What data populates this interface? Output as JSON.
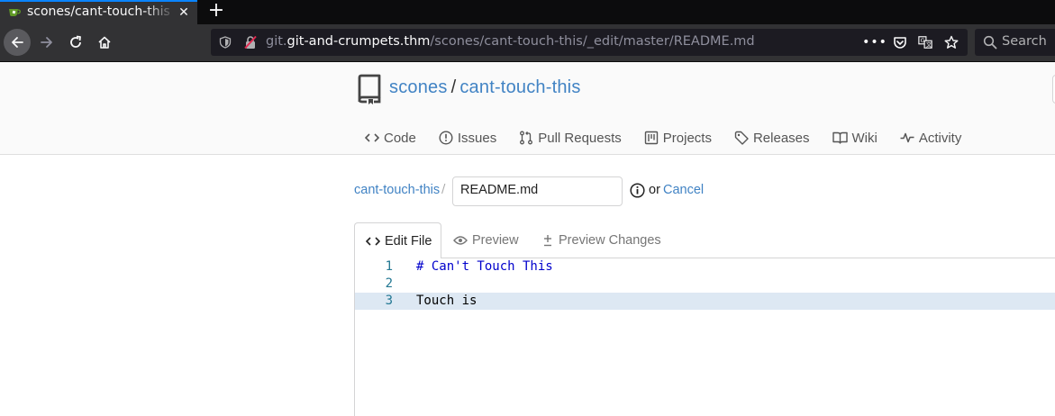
{
  "browser": {
    "tab_title": "scones/cant-touch-this – ",
    "tab_close": "✕",
    "new_tab": "+",
    "url_prefix": "git.",
    "url_host": "git-and-crumpets.thm",
    "url_path": "/scones/cant-touch-this/_edit/master/README.md",
    "search_placeholder": "Search"
  },
  "repo": {
    "owner": "scones",
    "separator": "/",
    "name": "cant-touch-this"
  },
  "repo_tabs": [
    {
      "label": "Code",
      "icon": "code-icon"
    },
    {
      "label": "Issues",
      "icon": "issue-icon"
    },
    {
      "label": "Pull Requests",
      "icon": "pull-request-icon"
    },
    {
      "label": "Projects",
      "icon": "project-icon"
    },
    {
      "label": "Releases",
      "icon": "tag-icon"
    },
    {
      "label": "Wiki",
      "icon": "book-icon"
    },
    {
      "label": "Activity",
      "icon": "pulse-icon"
    }
  ],
  "edit_form": {
    "breadcrumb_repo": "cant-touch-this",
    "breadcrumb_sep": "/",
    "filename": "README.md",
    "or_label": "or",
    "cancel_label": "Cancel"
  },
  "editor_tabs": {
    "edit_file": "Edit File",
    "preview": "Preview",
    "preview_changes": "Preview Changes"
  },
  "editor": {
    "lines": [
      {
        "number": "1",
        "text": "# Can't Touch This"
      },
      {
        "number": "2",
        "text": ""
      },
      {
        "number": "3",
        "text": "Touch is"
      }
    ],
    "current_line": 3
  },
  "colors": {
    "link": "#4183c4",
    "current_line": "#dde8f3",
    "heading_code": "#0000cc",
    "browser_accent": "#0a84ff"
  }
}
